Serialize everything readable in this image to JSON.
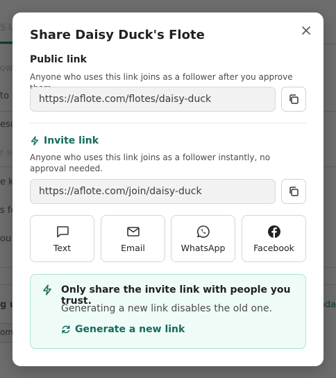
{
  "background": {
    "tab_fragment": "S U",
    "row_fragments": [
      "ow",
      "to",
      "escr",
      "r su",
      "e kn",
      "s fo",
      "ou",
      "g u",
      "omi"
    ],
    "right_fragment": "nda"
  },
  "modal": {
    "title": "Share Daisy Duck's Flote",
    "close_icon": "close-icon",
    "public": {
      "label": "Public link",
      "description": "Anyone who uses this link joins as a follower after you approve them.",
      "url": "https://aflote.com/flotes/daisy-duck"
    },
    "invite": {
      "label": "Invite link",
      "description": "Anyone who uses this link joins as a follower instantly, no approval needed.",
      "url": "https://aflote.com/join/daisy-duck"
    },
    "share_options": [
      {
        "label": "Text",
        "icon": "message-icon"
      },
      {
        "label": "Email",
        "icon": "mail-icon"
      },
      {
        "label": "WhatsApp",
        "icon": "whatsapp-icon"
      },
      {
        "label": "Facebook",
        "icon": "facebook-icon"
      }
    ],
    "notice": {
      "title": "Only share the invite link with people you trust.",
      "body": "Generating a new link disables the old one.",
      "action": "Generate a new link"
    }
  },
  "colors": {
    "accent": "#146b5c",
    "notice_bg": "#effbf7",
    "notice_border": "#a8e3d2"
  }
}
